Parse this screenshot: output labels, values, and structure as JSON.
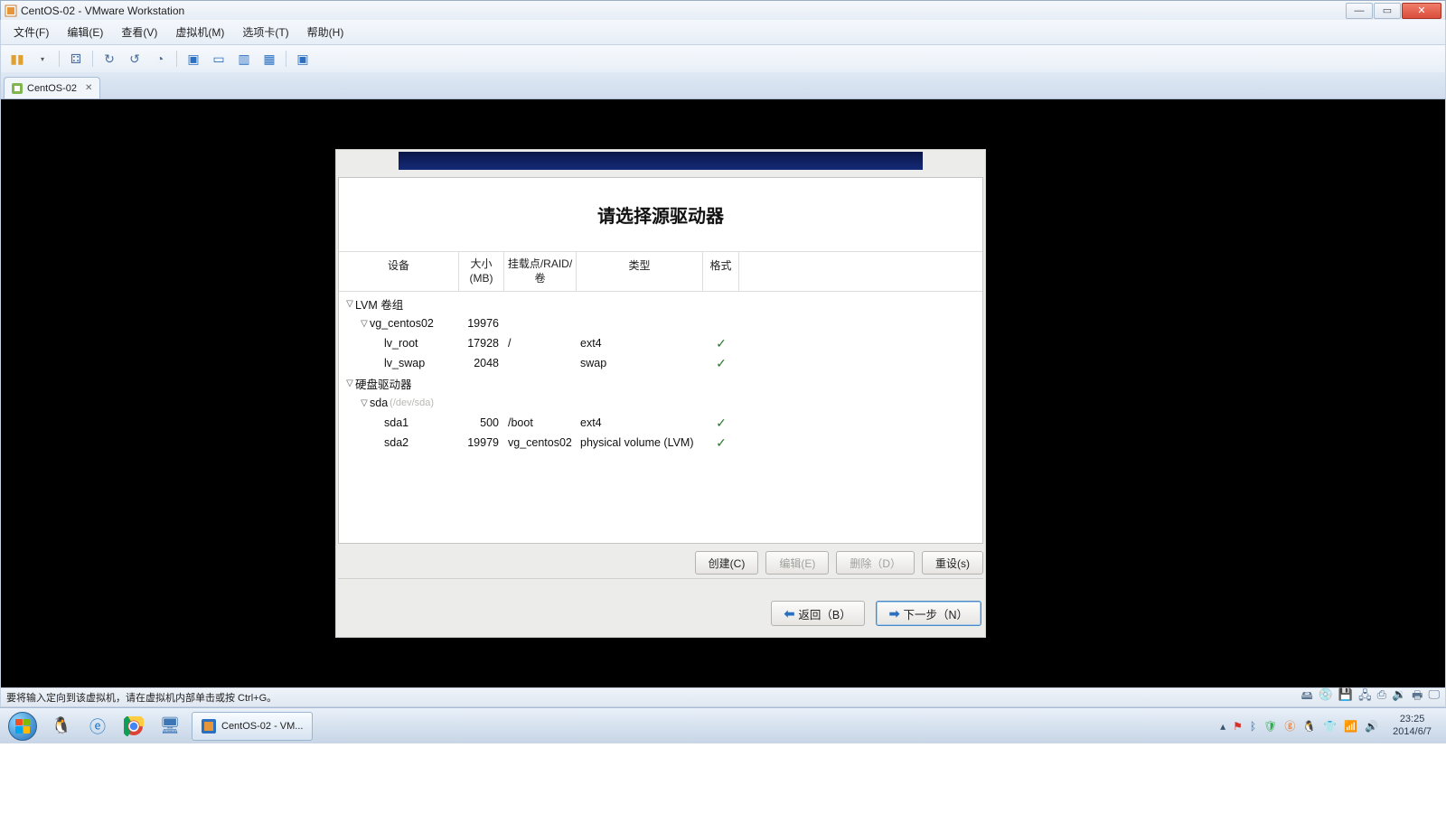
{
  "window": {
    "title": "CentOS-02 - VMware Workstation",
    "min": "—",
    "max": "▭",
    "close": "✕"
  },
  "menubar": [
    "文件(F)",
    "编辑(E)",
    "查看(V)",
    "虚拟机(M)",
    "选项卡(T)",
    "帮助(H)"
  ],
  "tab": {
    "label": "CentOS-02",
    "close": "✕"
  },
  "installer": {
    "title": "请选择源驱动器",
    "headers": {
      "device": "设备",
      "size": "大小(MB)",
      "mount": "挂载点/RAID/卷",
      "type": "类型",
      "fmt": "格式"
    },
    "group_lvm": "LVM 卷组",
    "vg_name": "vg_centos02",
    "vg_size": "19976",
    "lv_root_name": "lv_root",
    "lv_root_size": "17928",
    "lv_root_mount": "/",
    "lv_root_type": "ext4",
    "lv_swap_name": "lv_swap",
    "lv_swap_size": "2048",
    "lv_swap_type": "swap",
    "group_hd": "硬盘驱动器",
    "sda_name": "sda",
    "sda_dev": "(/dev/sda)",
    "sda1_name": "sda1",
    "sda1_size": "500",
    "sda1_mount": "/boot",
    "sda1_type": "ext4",
    "sda2_name": "sda2",
    "sda2_size": "19979",
    "sda2_mount": "vg_centos02",
    "sda2_type": "physical volume (LVM)",
    "check": "✓",
    "btn_create": "创建(C)",
    "btn_edit": "编辑(E)",
    "btn_delete": "删除（D）",
    "btn_reset": "重设(s)",
    "btn_back": "返回（B）",
    "btn_next": "下一步（N）"
  },
  "statusbar": {
    "hint": "要将输入定向到该虚拟机，请在虚拟机内部单击或按 Ctrl+G。"
  },
  "task": {
    "label": "CentOS-02 - VM..."
  },
  "clock": {
    "time": "23:25",
    "date": "2014/6/7"
  }
}
